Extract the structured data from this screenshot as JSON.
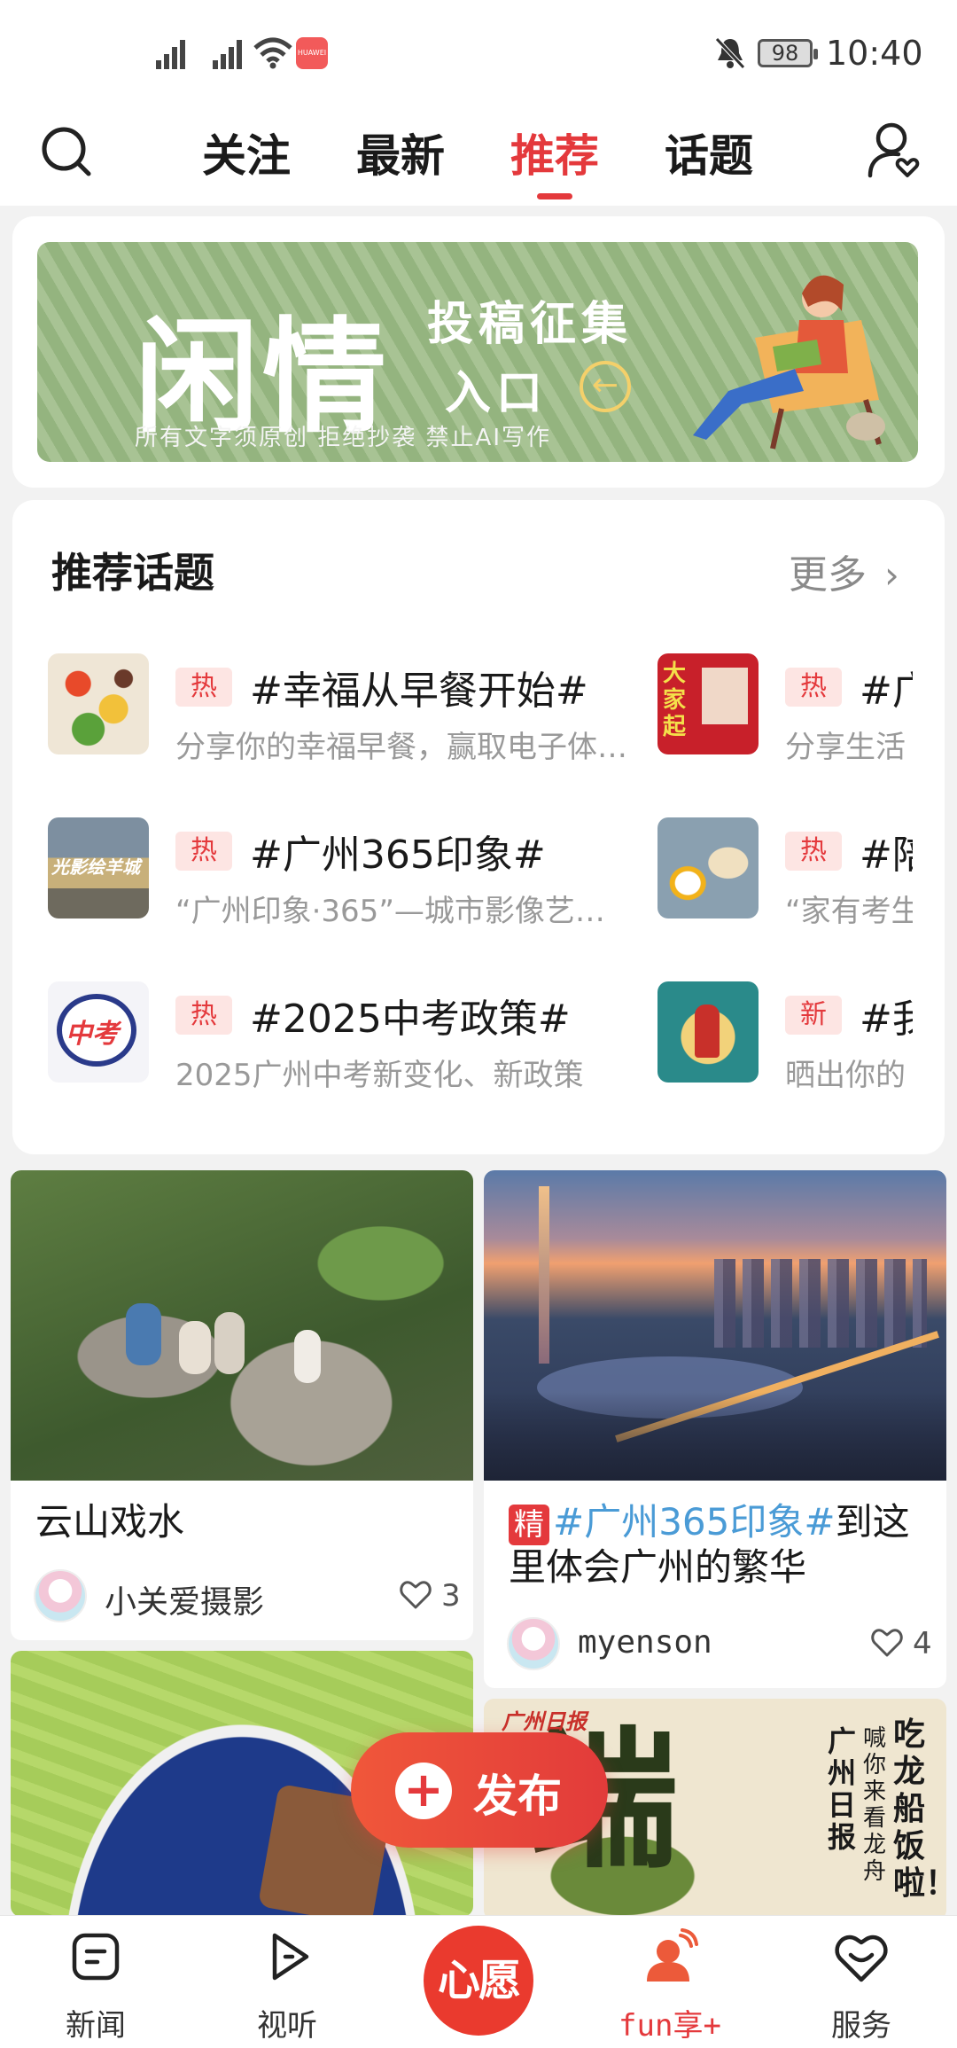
{
  "status_bar": {
    "time": "10:40",
    "battery": "98",
    "carrier_badge": "HUAWEI"
  },
  "top_nav": {
    "tabs": [
      "关注",
      "最新",
      "推荐",
      "话题"
    ],
    "active_tab": "推荐"
  },
  "banner": {
    "title": "闲情",
    "subtitle_line1": "投稿征集",
    "subtitle_line2": "入口",
    "note": "所有文字须原创 拒绝抄袭 禁止AI写作"
  },
  "topics_section": {
    "title": "推荐话题",
    "more": "更多",
    "items": [
      {
        "badge": "热",
        "title": "#幸福从早餐开始#",
        "desc": "分享你的幸福早餐，赢取电子体…",
        "thumb": "breakfast-vegetables"
      },
      {
        "badge": "热",
        "title": "#广",
        "desc": "分享生活",
        "thumb": "red-poster"
      },
      {
        "badge": "热",
        "title": "#广州365印象#",
        "desc": "“广州印象·365”—城市影像艺…",
        "thumb": "city-collage"
      },
      {
        "badge": "热",
        "title": "#陪",
        "desc": "“家有考生",
        "thumb": "breakfast-table"
      },
      {
        "badge": "热",
        "title": "#2025中考政策#",
        "desc": "2025广州中考新变化、新政策",
        "thumb": "exam-logo"
      },
      {
        "badge": "新",
        "title": "#我",
        "desc": "晒出你的",
        "thumb": "reading-girl"
      }
    ]
  },
  "feed": [
    {
      "title": "云山戏水",
      "author": "小关爱摄影",
      "likes": "3"
    },
    {
      "tag": "精",
      "hashtag": "#广州365印象#",
      "title": "到这里体会广州的繁华",
      "author": "myenson",
      "likes": "4"
    },
    {
      "title": ""
    },
    {
      "overlay_text": "广州日报",
      "overlay_side": "吃龙船饭啦！",
      "overlay_small": "喊你来看龙舟"
    }
  ],
  "publish_button": {
    "label": "发布"
  },
  "bottom_nav": {
    "items": [
      {
        "label": "新闻",
        "icon": "news-icon"
      },
      {
        "label": "视听",
        "icon": "play-icon"
      },
      {
        "label": "心愿",
        "icon": "wish-button"
      },
      {
        "label": "fun享+",
        "icon": "user-wave-icon"
      },
      {
        "label": "服务",
        "icon": "heart-smile-icon"
      }
    ],
    "active": "fun享+"
  },
  "colors": {
    "accent": "#e4393c",
    "background": "#f2f2f2",
    "banner_green": "#9ab984",
    "hashtag_blue": "#4a9bd6"
  }
}
